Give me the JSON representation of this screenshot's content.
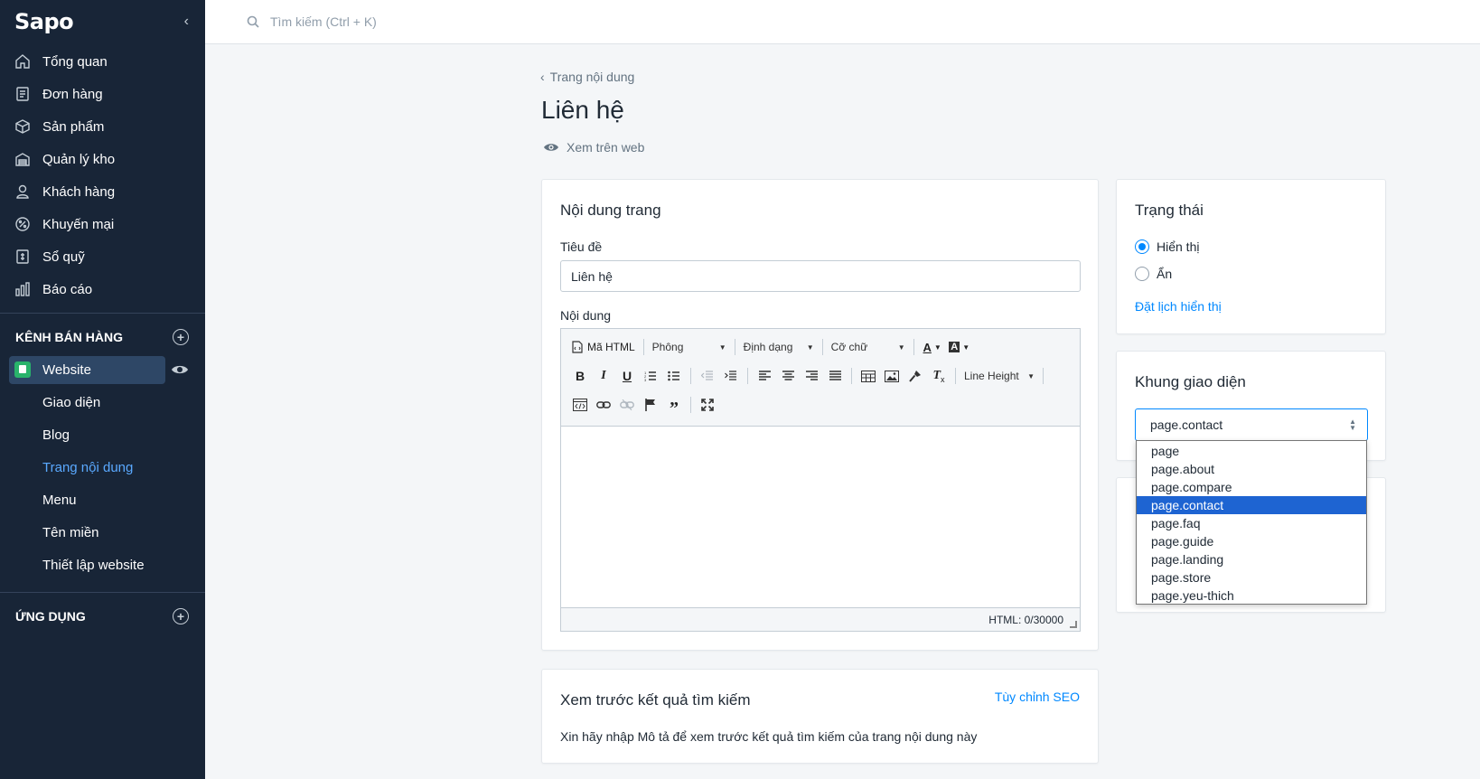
{
  "app": {
    "logo": "Sapo"
  },
  "sidebar": {
    "items": [
      {
        "label": "Tổng quan",
        "icon": "home-icon"
      },
      {
        "label": "Đơn hàng",
        "icon": "order-icon"
      },
      {
        "label": "Sản phẩm",
        "icon": "box-icon"
      },
      {
        "label": "Quản lý kho",
        "icon": "warehouse-icon"
      },
      {
        "label": "Khách hàng",
        "icon": "user-icon"
      },
      {
        "label": "Khuyến mại",
        "icon": "percent-icon"
      },
      {
        "label": "Sổ quỹ",
        "icon": "cashbook-icon"
      },
      {
        "label": "Báo cáo",
        "icon": "report-icon"
      }
    ],
    "sales_channel_heading": "KÊNH BÁN HÀNG",
    "website_label": "Website",
    "website_sub": [
      {
        "label": "Giao diện"
      },
      {
        "label": "Blog"
      },
      {
        "label": "Trang nội dung"
      },
      {
        "label": "Menu"
      },
      {
        "label": "Tên miền"
      },
      {
        "label": "Thiết lập website"
      }
    ],
    "apps_heading": "ỨNG DỤNG"
  },
  "search": {
    "placeholder": "Tìm kiếm (Ctrl + K)"
  },
  "page": {
    "back_label": "Trang nội dung",
    "title": "Liên hệ",
    "view_web": "Xem trên web"
  },
  "content_card": {
    "title": "Nội dung trang",
    "title_label": "Tiêu đề",
    "title_value": "Liên hệ",
    "content_label": "Nội dung"
  },
  "editor": {
    "html_btn": "Mã HTML",
    "font_select": "Phông",
    "format_select": "Định dạng",
    "size_select": "Cỡ chữ",
    "line_height": "Line Height",
    "status": "HTML: 0/30000"
  },
  "seo_card": {
    "title": "Xem trước kết quả tìm kiếm",
    "customize_link": "Tùy chỉnh SEO",
    "hint": "Xin hãy nhập Mô tả để xem trước kết quả tìm kiếm của trang nội dung này"
  },
  "status_card": {
    "title": "Trạng thái",
    "option_show": "Hiển thị",
    "option_hide": "Ẩn",
    "schedule_link": "Đặt lịch hiển thị"
  },
  "template_card": {
    "title": "Khung giao diện",
    "selected": "page.contact",
    "options": [
      "page",
      "page.about",
      "page.compare",
      "page.contact",
      "page.faq",
      "page.guide",
      "page.landing",
      "page.store",
      "page.yeu-thich"
    ]
  },
  "colors": {
    "sidebar_bg": "#182537",
    "accent": "#0088ff",
    "active_sub": "#5aa9ff",
    "dropdown_selected": "#1e64d2"
  }
}
